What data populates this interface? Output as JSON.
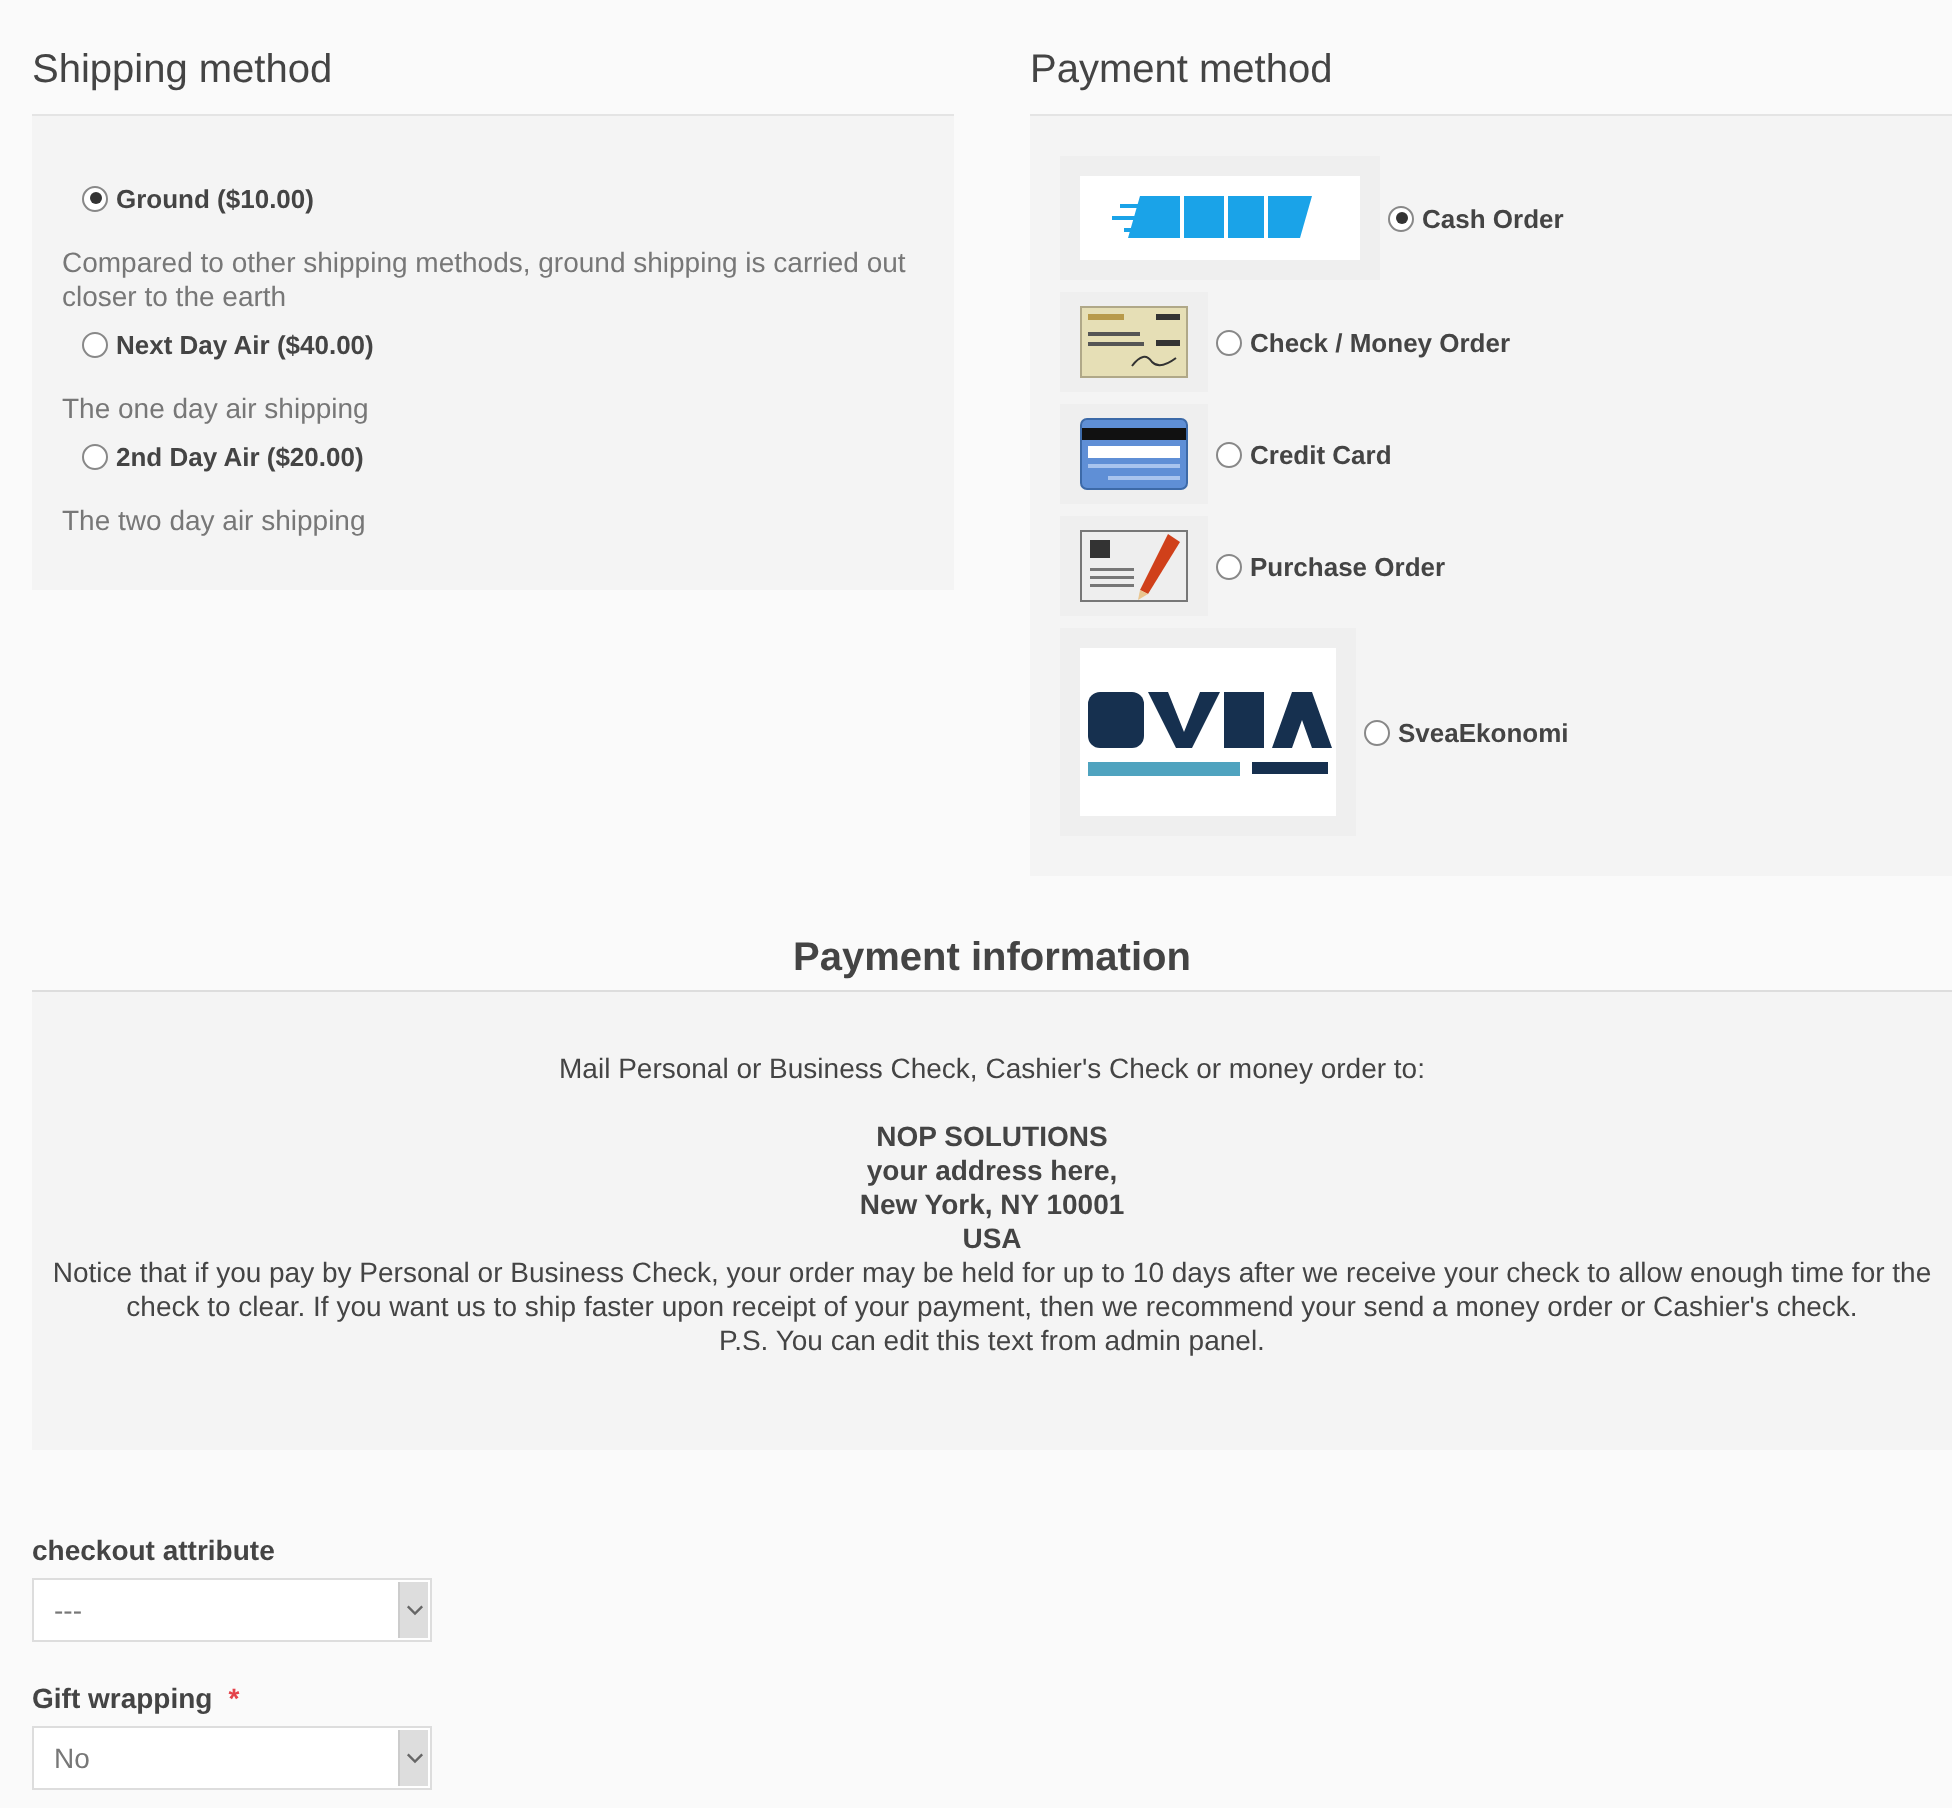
{
  "shipping": {
    "title": "Shipping method",
    "options": [
      {
        "label": "Ground ($10.00)",
        "selected": true,
        "description": "Compared to other shipping methods, ground shipping is carried out closer to the earth"
      },
      {
        "label": "Next Day Air ($40.00)",
        "selected": false,
        "description": "The one day air shipping"
      },
      {
        "label": "2nd Day Air ($20.00)",
        "selected": false,
        "description": "The two day air shipping"
      }
    ]
  },
  "payment": {
    "title": "Payment method",
    "options": [
      {
        "label": "Cash Order",
        "selected": true,
        "kind": "cash"
      },
      {
        "label": "Check / Money Order",
        "selected": false,
        "kind": "check"
      },
      {
        "label": "Credit Card",
        "selected": false,
        "kind": "card"
      },
      {
        "label": "Purchase Order",
        "selected": false,
        "kind": "po"
      },
      {
        "label": "SveaEkonomi",
        "selected": false,
        "kind": "svea"
      }
    ]
  },
  "payment_info": {
    "title": "Payment information",
    "paragraphs": [
      [
        {
          "text": "Mail Personal or Business Check, Cashier's Check or money order to:",
          "bold": false
        }
      ],
      [
        {
          "text": "NOP SOLUTIONS",
          "bold": true
        },
        {
          "text": "your address here,",
          "bold": true
        },
        {
          "text": "New York, NY 10001",
          "bold": true
        },
        {
          "text": "USA",
          "bold": true
        },
        {
          "text": "Notice that if you pay by Personal or Business Check, your order may be held for up to 10 days after we receive your check to allow enough time for the check to clear. If you want us to ship faster upon receipt of your payment, then we recommend your send a money order or Cashier's check.",
          "bold": false
        },
        {
          "text": "P.S. You can edit this text from admin panel.",
          "bold": false
        }
      ]
    ]
  },
  "attributes": [
    {
      "label": "checkout attribute",
      "required": false,
      "value": "---"
    },
    {
      "label": "Gift wrapping",
      "required": true,
      "required_mark": "*",
      "value": "No"
    }
  ]
}
